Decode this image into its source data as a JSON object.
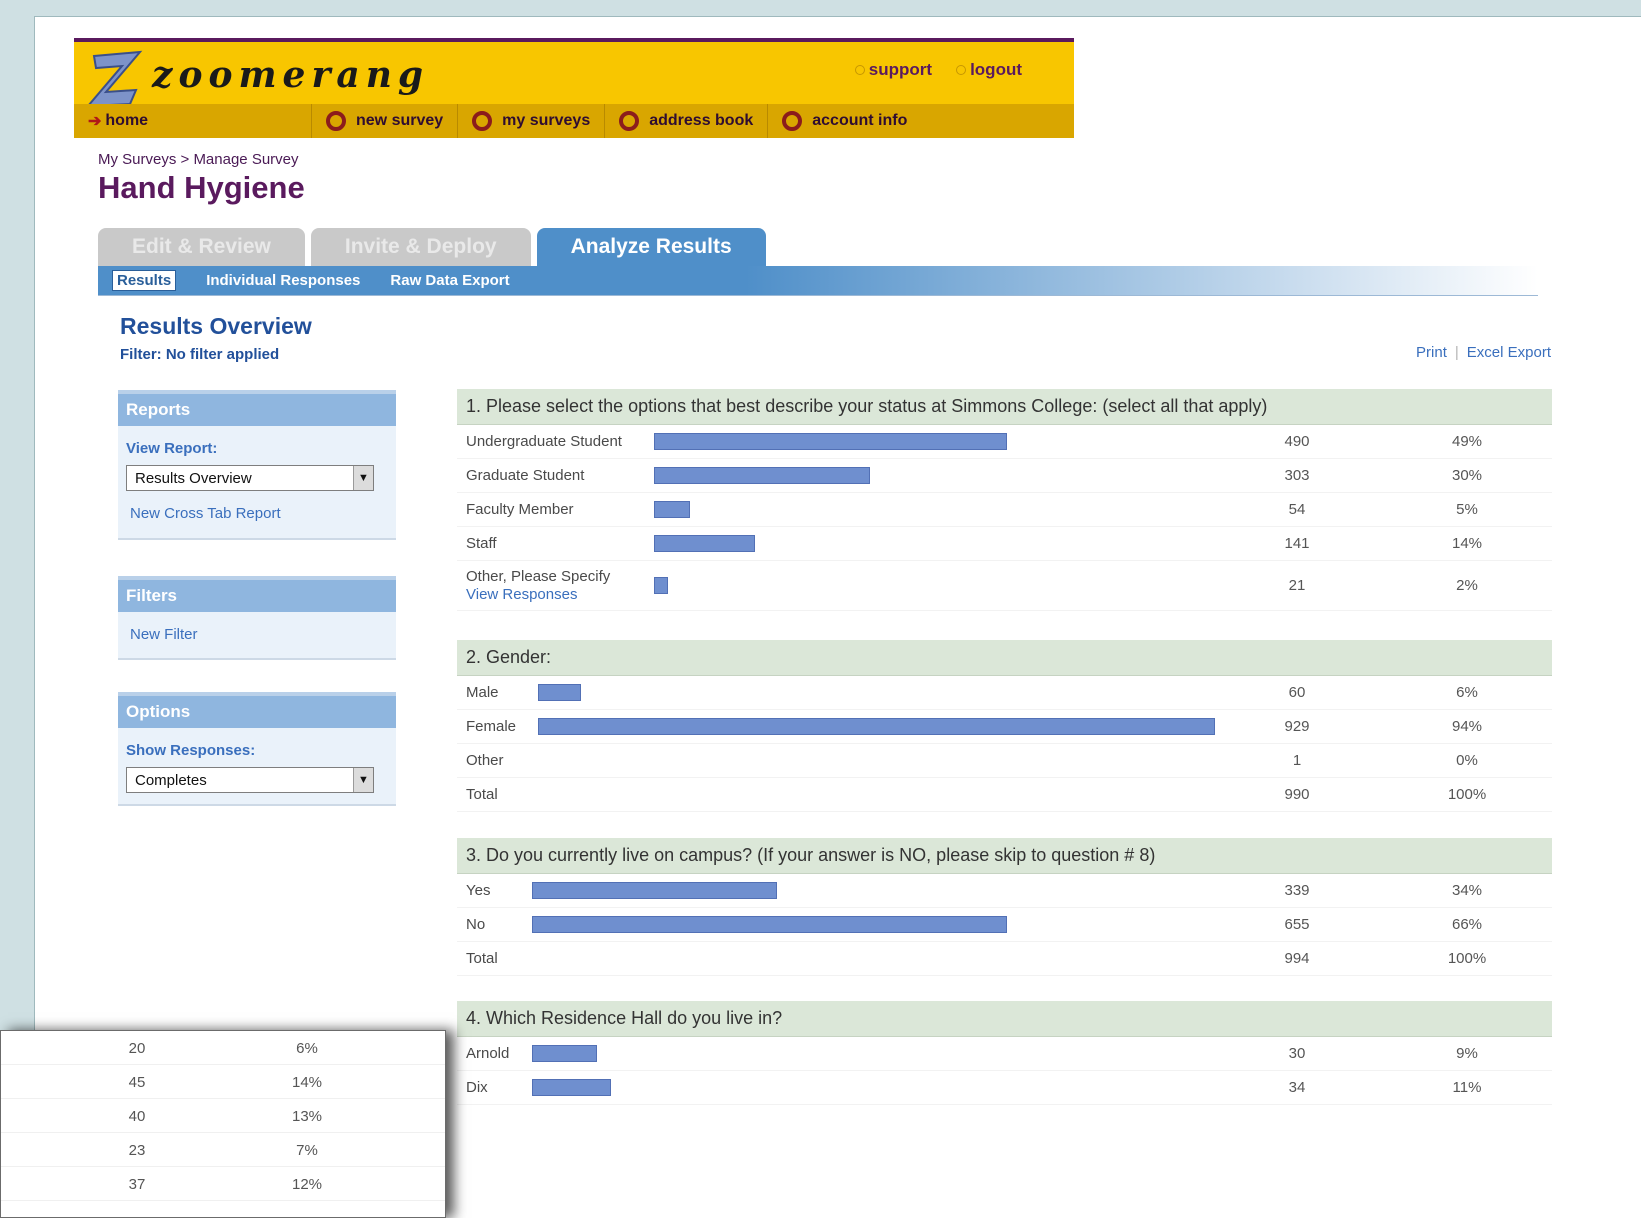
{
  "brand": {
    "name": "zoomerang",
    "utility_links": [
      "support",
      "logout"
    ],
    "nav": {
      "home": "home",
      "items": [
        "new survey",
        "my surveys",
        "address book",
        "account info"
      ]
    },
    "colors": {
      "header": "#f8c600",
      "nav": "#d9a600",
      "purple": "#5a1a5e"
    }
  },
  "breadcrumb": "My Surveys > Manage Survey",
  "survey_title": "Hand Hygiene",
  "tabs": [
    {
      "label": "Edit & Review",
      "active": false
    },
    {
      "label": "Invite & Deploy",
      "active": false
    },
    {
      "label": "Analyze Results",
      "active": true
    }
  ],
  "subtabs": [
    {
      "label": "Results",
      "selected": true
    },
    {
      "label": "Individual Responses",
      "selected": false
    },
    {
      "label": "Raw Data Export",
      "selected": false
    }
  ],
  "overview": {
    "title": "Results Overview",
    "filter": "Filter: No filter applied",
    "print": "Print",
    "excel": "Excel Export"
  },
  "panels": {
    "reports": {
      "title": "Reports",
      "label": "View Report:",
      "selected": "Results Overview",
      "link": "New Cross Tab Report"
    },
    "filters": {
      "title": "Filters",
      "link": "New Filter"
    },
    "options": {
      "title": "Options",
      "label": "Show Responses:",
      "selected": "Completes"
    }
  },
  "questions": [
    {
      "title": "1. Please select the options that best describe your status at Simmons College: (select all that apply)",
      "rows": [
        {
          "label": "Undergraduate Student",
          "count": "490",
          "pct": "49%",
          "value": 0.49
        },
        {
          "label": "Graduate Student",
          "count": "303",
          "pct": "30%",
          "value": 0.3
        },
        {
          "label": "Faculty Member",
          "count": "54",
          "pct": "5%",
          "value": 0.05
        },
        {
          "label": "Staff",
          "count": "141",
          "pct": "14%",
          "value": 0.14
        },
        {
          "label": "Other, Please Specify",
          "sublink": "View Responses",
          "count": "21",
          "pct": "2%",
          "value": 0.02
        }
      ]
    },
    {
      "title": "2. Gender:",
      "rows": [
        {
          "label": "Male",
          "count": "60",
          "pct": "6%",
          "value": 0.06
        },
        {
          "label": "Female",
          "count": "929",
          "pct": "94%",
          "value": 0.94
        },
        {
          "label": "Other",
          "count": "1",
          "pct": "0%",
          "value": 0.0
        },
        {
          "label": "Total",
          "count": "990",
          "pct": "100%"
        }
      ]
    },
    {
      "title": "3. Do you currently live on campus? (If your answer is NO, please skip to question # 8)",
      "rows": [
        {
          "label": "Yes",
          "count": "339",
          "pct": "34%",
          "value": 0.34
        },
        {
          "label": "No",
          "count": "655",
          "pct": "66%",
          "value": 0.66
        },
        {
          "label": "Total",
          "count": "994",
          "pct": "100%"
        }
      ]
    },
    {
      "title": "4. Which Residence Hall do you live in?",
      "rows": [
        {
          "label": "Arnold",
          "count": "30",
          "pct": "9%",
          "value": 0.09
        },
        {
          "label": "Dix",
          "count": "34",
          "pct": "11%",
          "value": 0.11
        }
      ]
    }
  ],
  "overlay_rows": [
    {
      "count": "20",
      "pct": "6%"
    },
    {
      "count": "45",
      "pct": "14%"
    },
    {
      "count": "40",
      "pct": "13%"
    },
    {
      "count": "23",
      "pct": "7%"
    },
    {
      "count": "37",
      "pct": "12%"
    }
  ]
}
